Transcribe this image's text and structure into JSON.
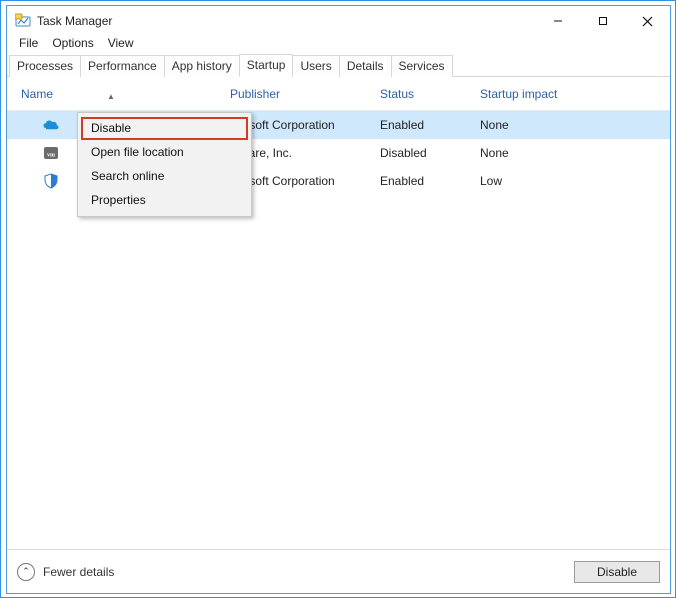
{
  "window": {
    "title": "Task Manager"
  },
  "menu": {
    "file": "File",
    "options": "Options",
    "view": "View"
  },
  "tabs": {
    "processes": "Processes",
    "performance": "Performance",
    "apphistory": "App history",
    "startup": "Startup",
    "users": "Users",
    "details": "Details",
    "services": "Services"
  },
  "columns": {
    "name": "Name",
    "publisher": "Publisher",
    "status": "Status",
    "impact": "Startup impact"
  },
  "rows": [
    {
      "name": "",
      "publisher": "icrosoft Corporation",
      "status": "Enabled",
      "impact": "None"
    },
    {
      "name": "",
      "publisher": "Mware, Inc.",
      "status": "Disabled",
      "impact": "None"
    },
    {
      "name": "",
      "publisher": "icrosoft Corporation",
      "status": "Enabled",
      "impact": "Low"
    }
  ],
  "context_menu": {
    "disable": "Disable",
    "open_location": "Open file location",
    "search_online": "Search online",
    "properties": "Properties"
  },
  "bottom": {
    "fewer": "Fewer details",
    "disable": "Disable"
  }
}
